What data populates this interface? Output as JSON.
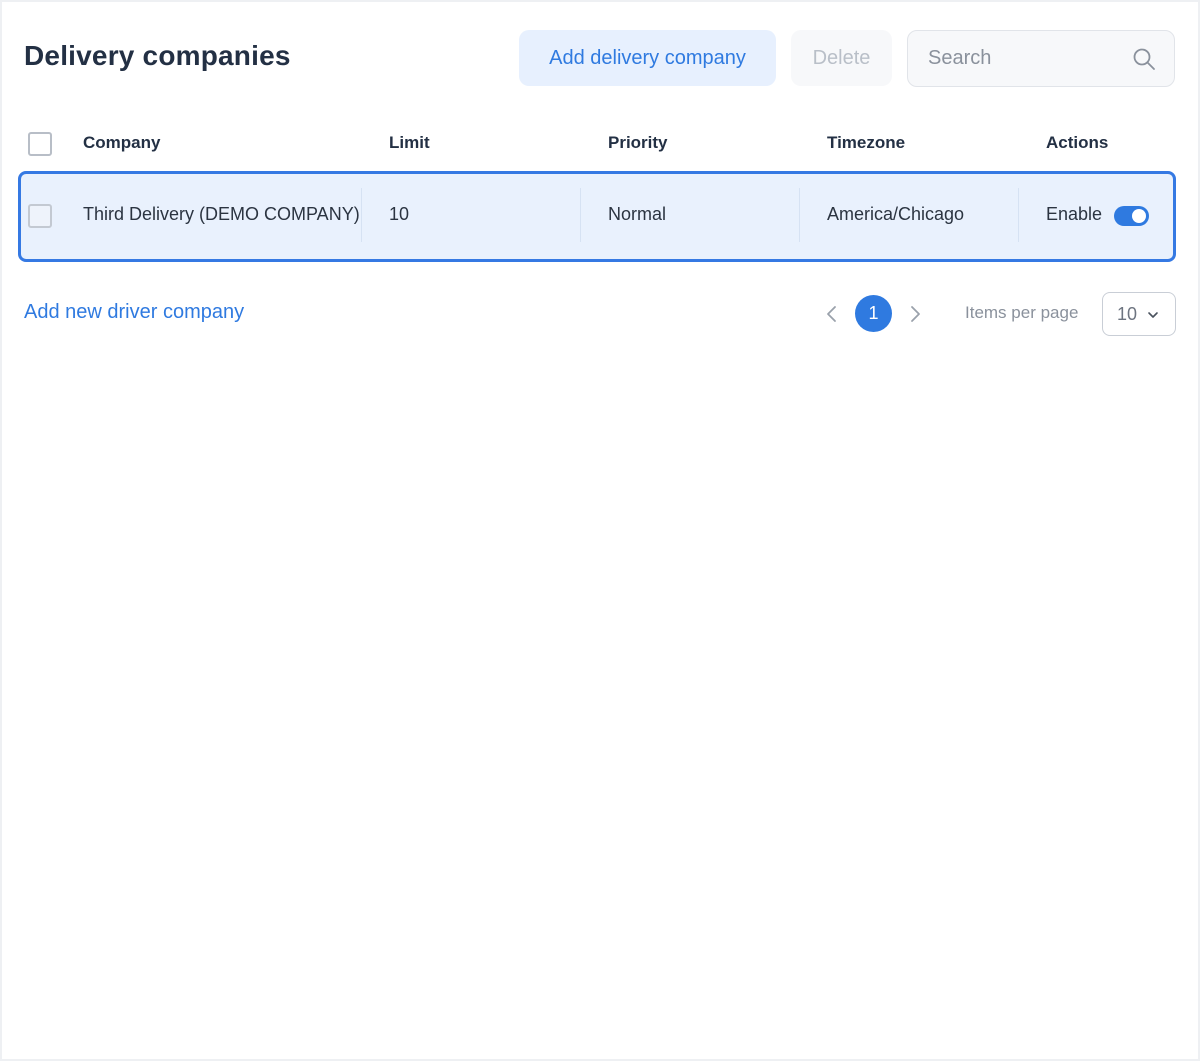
{
  "header": {
    "title": "Delivery companies",
    "add_button": "Add delivery company",
    "delete_button": "Delete",
    "search_placeholder": "Search"
  },
  "table": {
    "columns": [
      "Company",
      "Limit",
      "Priority",
      "Timezone",
      "Actions"
    ],
    "rows": [
      {
        "company": "Third Delivery (DEMO COMPANY)",
        "limit": "10",
        "priority": "Normal",
        "timezone": "America/Chicago",
        "action_label": "Enable",
        "enabled": true,
        "selected": false
      }
    ]
  },
  "footer": {
    "add_driver_link": "Add new driver company",
    "current_page": "1",
    "items_per_page_label": "Items per page",
    "items_per_page_value": "10"
  },
  "colors": {
    "accent": "#2f7ae0",
    "row_highlight": "#e9f1fd",
    "row_border": "#3579e3"
  }
}
